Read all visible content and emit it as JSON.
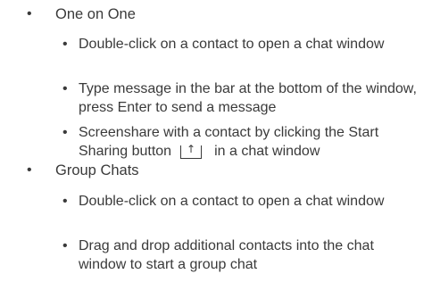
{
  "bullet_glyph": "•",
  "sections": [
    {
      "title": "One on One",
      "items": [
        {
          "text": "Double-click on a contact to open a chat window"
        },
        {
          "text": "Type message in the bar at the bottom of the window, press Enter to send a message"
        },
        {
          "text_before": "Screenshare with a contact by clicking the Start Sharing button",
          "icon": "start-sharing-icon",
          "text_after": "in a chat window"
        }
      ]
    },
    {
      "title": "Group Chats",
      "items": [
        {
          "text": "Double-click on a contact to open a chat window"
        },
        {
          "text": "Drag and drop additional contacts into the chat window to start a group chat"
        }
      ]
    }
  ]
}
